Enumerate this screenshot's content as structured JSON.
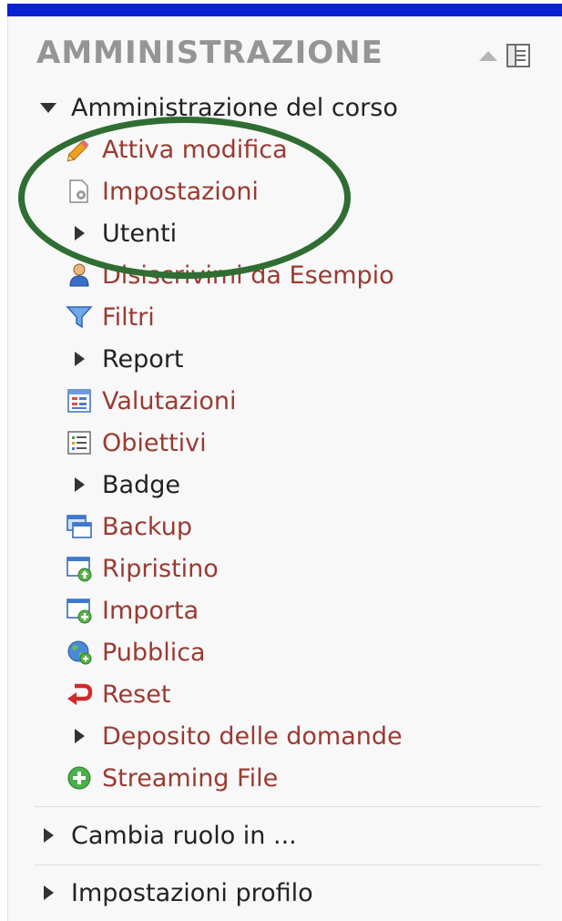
{
  "block": {
    "title": "AMMINISTRAZIONE",
    "controls": {
      "collapse_icon": "caret-up-icon",
      "dock_icon": "dock-icon"
    }
  },
  "course_admin": {
    "label": "Amministrazione del corso",
    "items": [
      {
        "label": "Attiva modifica",
        "icon": "pencil-icon",
        "type": "link"
      },
      {
        "label": "Impostazioni",
        "icon": "settings-document-icon",
        "type": "link"
      },
      {
        "label": "Utenti",
        "icon": "caret-right-icon",
        "type": "branch"
      },
      {
        "label": "Disiscrivimi da Esempio",
        "icon": "user-icon",
        "type": "link"
      },
      {
        "label": "Filtri",
        "icon": "filter-icon",
        "type": "link"
      },
      {
        "label": "Report",
        "icon": "caret-right-icon",
        "type": "branch"
      },
      {
        "label": "Valutazioni",
        "icon": "grades-icon",
        "type": "link"
      },
      {
        "label": "Obiettivi",
        "icon": "outcomes-icon",
        "type": "link"
      },
      {
        "label": "Badge",
        "icon": "caret-right-icon",
        "type": "branch"
      },
      {
        "label": "Backup",
        "icon": "backup-icon",
        "type": "link"
      },
      {
        "label": "Ripristino",
        "icon": "restore-icon",
        "type": "link"
      },
      {
        "label": "Importa",
        "icon": "import-icon",
        "type": "link"
      },
      {
        "label": "Pubblica",
        "icon": "globe-icon",
        "type": "link"
      },
      {
        "label": "Reset",
        "icon": "reset-icon",
        "type": "link"
      },
      {
        "label": "Deposito delle domande",
        "icon": "caret-right-icon",
        "type": "branch-link"
      },
      {
        "label": "Streaming File",
        "icon": "plus-circle-icon",
        "type": "link"
      }
    ]
  },
  "bottom_items": [
    {
      "label": "Cambia ruolo in ...",
      "icon": "caret-right-icon"
    },
    {
      "label": "Impostazioni profilo",
      "icon": "caret-right-icon"
    }
  ],
  "colors": {
    "link": "#9a3a32",
    "text": "#222222",
    "header": "#959595",
    "highlight": "#2f6d33",
    "topbar": "#0a22d0"
  }
}
